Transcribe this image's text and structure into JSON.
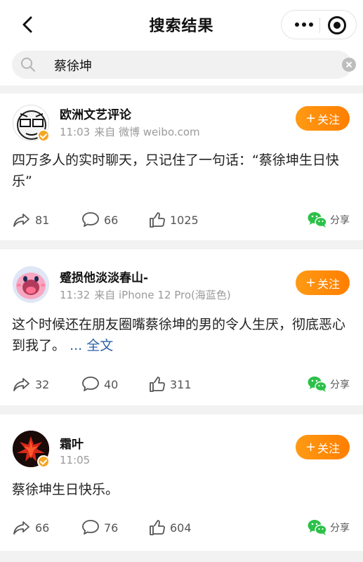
{
  "header": {
    "title": "搜索结果",
    "back_icon": "chevron-left-icon",
    "more_icon": "more-dots-icon",
    "target_icon": "target-icon"
  },
  "search": {
    "query": "蔡徐坤",
    "icon": "search-icon",
    "clear_icon": "clear-icon"
  },
  "posts": [
    {
      "user": "欧洲文艺评论",
      "time": "11:03",
      "source": "来自 微博 weibo.com",
      "follow": "关注",
      "text": "四万多人的实时聊天，只记住了一句话：“蔡徐坤生日快乐”",
      "more": "",
      "reposts": "81",
      "comments": "66",
      "likes": "1025",
      "share": "分享",
      "verified": true
    },
    {
      "user": "蹙损他淡淡春山-",
      "time": "11:32",
      "source": "来自 iPhone 12 Pro(海蓝色)",
      "follow": "关注",
      "text": "这个时候还在朋友圈嘴蔡徐坤的男的令人生厌，彻底恶心到我了。",
      "more": "... 全文",
      "reposts": "32",
      "comments": "40",
      "likes": "311",
      "share": "分享",
      "verified": false
    },
    {
      "user": "霜叶",
      "time": "11:05",
      "source": "",
      "follow": "关注",
      "text": "蔡徐坤生日快乐。",
      "more": "",
      "reposts": "66",
      "comments": "76",
      "likes": "604",
      "share": "分享",
      "verified": true
    }
  ],
  "colors": {
    "accent": "#ff8a0a",
    "link": "#2a62a8",
    "wechat_green": "#2bc148",
    "verified": "#f6a623"
  }
}
